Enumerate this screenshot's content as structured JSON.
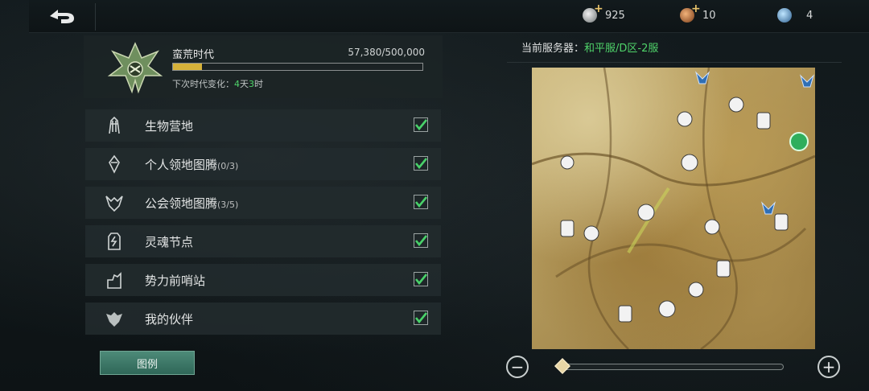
{
  "resources": [
    {
      "icon": "silver-coin-icon",
      "value": "925",
      "has_plus": true
    },
    {
      "icon": "bronze-token-icon",
      "value": "10",
      "has_plus": true
    },
    {
      "icon": "blue-gem-icon",
      "value": "4",
      "has_plus": false
    }
  ],
  "era": {
    "title": "蛮荒时代",
    "count": "57,380/500,000",
    "progress": 0.1148,
    "next_label": "下次时代变化：",
    "days": "4",
    "days_unit": "天",
    "hours": "3",
    "hours_unit": "时"
  },
  "filters": [
    {
      "label": "生物营地",
      "extra": "",
      "icon": "creature-camp-icon",
      "checked": true
    },
    {
      "label": "个人领地图腾",
      "extra": "(0/3)",
      "icon": "personal-totem-icon",
      "checked": true
    },
    {
      "label": "公会领地图腾",
      "extra": "(3/5)",
      "icon": "guild-totem-icon",
      "checked": true
    },
    {
      "label": "灵魂节点",
      "extra": "",
      "icon": "soul-node-icon",
      "checked": true
    },
    {
      "label": "势力前哨站",
      "extra": "",
      "icon": "faction-outpost-icon",
      "checked": true
    },
    {
      "label": "我的伙伴",
      "extra": "",
      "icon": "companion-icon",
      "checked": true
    }
  ],
  "legend_button": "图例",
  "server": {
    "label": "当前服务器：",
    "value": "和平服/D区-2服"
  },
  "zoom": {
    "level": 0.0
  },
  "colors": {
    "accent_green": "#4fd36a",
    "progress_gold": "#d6b23a",
    "button_teal": "#3f7a69"
  }
}
